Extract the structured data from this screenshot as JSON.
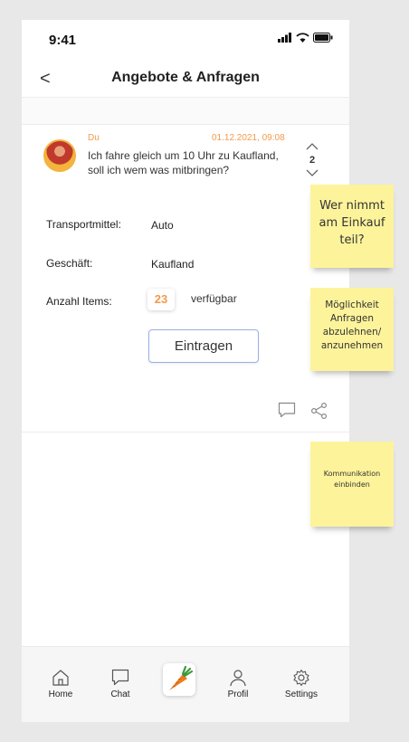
{
  "status": {
    "time": "9:41"
  },
  "header": {
    "back_symbol": "<",
    "title": "Angebote & Anfragen"
  },
  "message": {
    "author": "Du",
    "date": "01.12.2021, 09:08",
    "text": "Ich fahre gleich um 10 Uhr zu Kaufland, soll ich wem was mitbringen?",
    "votes": "2"
  },
  "details": {
    "transport_label": "Transportmittel:",
    "transport_value": "Auto",
    "shop_label": "Geschäft:",
    "shop_value": "Kaufland",
    "items_label": "Anzahl Items:",
    "items_count": "23",
    "items_status": "verfügbar"
  },
  "button": {
    "eintragen_label": "Eintragen"
  },
  "tabbar": {
    "home": "Home",
    "chat": "Chat",
    "profil": "Profil",
    "settings": "Settings"
  },
  "notes": {
    "note1": "Wer nimmt am Einkauf teil?",
    "note2": "Möglichkeit Anfragen abzulehnen/ anzunehmen",
    "note3": "Kommunikation einbinden"
  },
  "colors": {
    "accent": "#f39a4c",
    "sticky": "#fdf39b",
    "button_border": "#9aaee8"
  }
}
